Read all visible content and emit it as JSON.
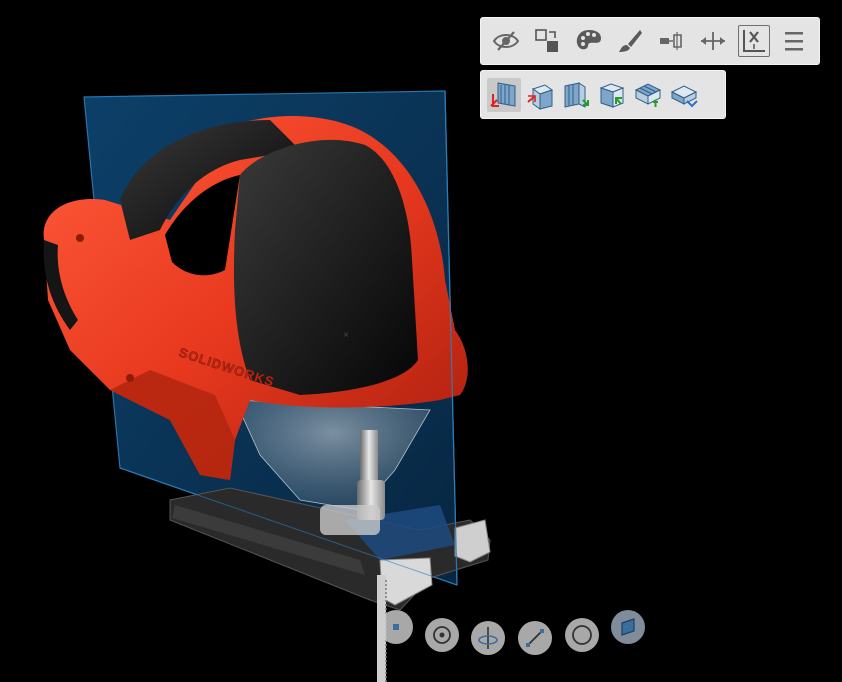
{
  "app": {
    "title": "",
    "viewport_background": "#000000"
  },
  "model": {
    "brand_text": "SOLIDWORKS",
    "shell_color": "#e8391f",
    "grip_color": "#1b1b1b",
    "section_plane_color": "#0b3d66"
  },
  "main_toolbar": {
    "buttons": [
      {
        "id": "hide-show",
        "icon": "eye-slash-icon"
      },
      {
        "id": "change-transparency",
        "icon": "transparency-icon"
      },
      {
        "id": "appearance",
        "icon": "palette-icon"
      },
      {
        "id": "edit-appearance",
        "icon": "brush-icon"
      },
      {
        "id": "exploded-view",
        "icon": "explode-icon"
      },
      {
        "id": "move-component",
        "icon": "move-icon"
      },
      {
        "id": "section-view",
        "icon": "section-view-icon",
        "boxed": true
      },
      {
        "id": "more",
        "icon": "menu-icon"
      }
    ]
  },
  "section_toolbar": {
    "buttons": [
      {
        "id": "front-section",
        "icon": "section-front-icon",
        "active": true
      },
      {
        "id": "right-section",
        "icon": "section-right-icon"
      },
      {
        "id": "top-section",
        "icon": "section-top-icon"
      },
      {
        "id": "reverse-section",
        "icon": "section-reverse-icon"
      },
      {
        "id": "add-plane",
        "icon": "section-add-plane-icon"
      },
      {
        "id": "cap-section",
        "icon": "section-cap-icon"
      }
    ]
  },
  "bottom_tools": [
    {
      "id": "point",
      "icon": "point-icon"
    },
    {
      "id": "center",
      "icon": "center-point-icon"
    },
    {
      "id": "axis-rotate",
      "icon": "rotate-axis-icon"
    },
    {
      "id": "line",
      "icon": "line-icon"
    },
    {
      "id": "circle",
      "icon": "circle-icon"
    },
    {
      "id": "face",
      "icon": "face-icon",
      "selected": true
    }
  ]
}
